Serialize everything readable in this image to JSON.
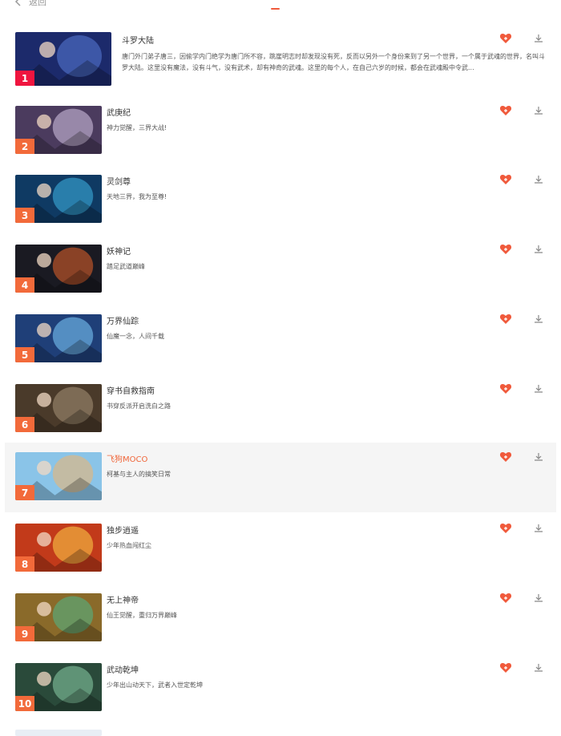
{
  "header": {
    "back_label": "返回"
  },
  "colors": {
    "accent": "#f05a3c",
    "rank_first": "#f0153f",
    "rank_other": "#f26a3a"
  },
  "items": [
    {
      "rank": "1",
      "title": "斗罗大陆",
      "desc": "唐门外门弟子唐三，因偷学内门绝学为唐门所不容，跳崖明志时却发现没有死，反而以另外一个身份来到了另一个世界，一个属于武魂的世界，名叫斗罗大陆。这里没有魔法，没有斗气，没有武术，却有神奇的武魂。这里的每个人，在自己六岁的时候，都会在武魂殿中令武...",
      "thumb_color": "#1c2a6b",
      "thumb_accent": "#5a7bd8"
    },
    {
      "rank": "2",
      "title": "武庚纪",
      "desc": "神力觉醒，三界大战!",
      "thumb_color": "#4b3b5e",
      "thumb_accent": "#d8c8e8"
    },
    {
      "rank": "3",
      "title": "灵剑尊",
      "desc": "天地三界，我为至尊!",
      "thumb_color": "#0f3a63",
      "thumb_accent": "#3fb7e8"
    },
    {
      "rank": "4",
      "title": "妖神记",
      "desc": "踏足武道巅峰",
      "thumb_color": "#1a1a22",
      "thumb_accent": "#e8642a"
    },
    {
      "rank": "5",
      "title": "万界仙踪",
      "desc": "仙魔一念，人间千载",
      "thumb_color": "#1f3f78",
      "thumb_accent": "#7fd0ff"
    },
    {
      "rank": "6",
      "title": "穿书自救指南",
      "desc": "书穿反派开启洗白之路",
      "thumb_color": "#4a3a2a",
      "thumb_accent": "#a89478"
    },
    {
      "rank": "7",
      "title": "飞狗MOCO",
      "desc": "柯基与主人的搞笑日常",
      "thumb_color": "#8ac4e8",
      "thumb_accent": "#f3b46a"
    },
    {
      "rank": "8",
      "title": "独步逍遥",
      "desc": "少年热血闯红尘",
      "thumb_color": "#c23a1a",
      "thumb_accent": "#ffd24a"
    },
    {
      "rank": "9",
      "title": "无上神帝",
      "desc": "仙王觉醒，重归万界巅峰",
      "thumb_color": "#8a6a2a",
      "thumb_accent": "#4fb88a"
    },
    {
      "rank": "10",
      "title": "武动乾坤",
      "desc": "少年出山动天下，武者入世定乾坤",
      "thumb_color": "#2a4a3a",
      "thumb_accent": "#8ad0a8"
    }
  ]
}
